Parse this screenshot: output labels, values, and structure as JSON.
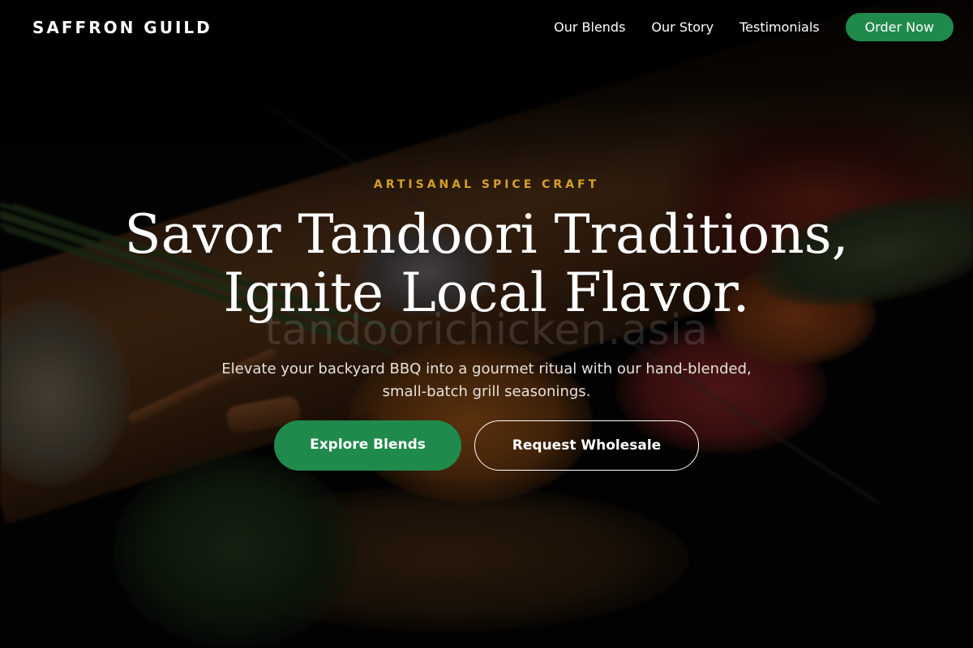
{
  "nav": {
    "brand": "SAFFRON GUILD",
    "links": [
      "Our Blends",
      "Our Story",
      "Testimonials"
    ],
    "cta": "Order Now"
  },
  "hero": {
    "eyebrow": "ARTISANAL SPICE CRAFT",
    "headline_line1": "Savor Tandoori Traditions,",
    "headline_line2": "Ignite Local Flavor.",
    "subtext": "Elevate your backyard BBQ into a gourmet ritual with our hand-blended, small-batch grill seasonings.",
    "primary_cta": "Explore Blends",
    "secondary_cta": "Request Wholesale",
    "watermark": "tandoorichicken.asia"
  },
  "colors": {
    "accent_green": "#1f8a4c",
    "eyebrow_gold": "#d4a02a",
    "text": "#ffffff"
  }
}
